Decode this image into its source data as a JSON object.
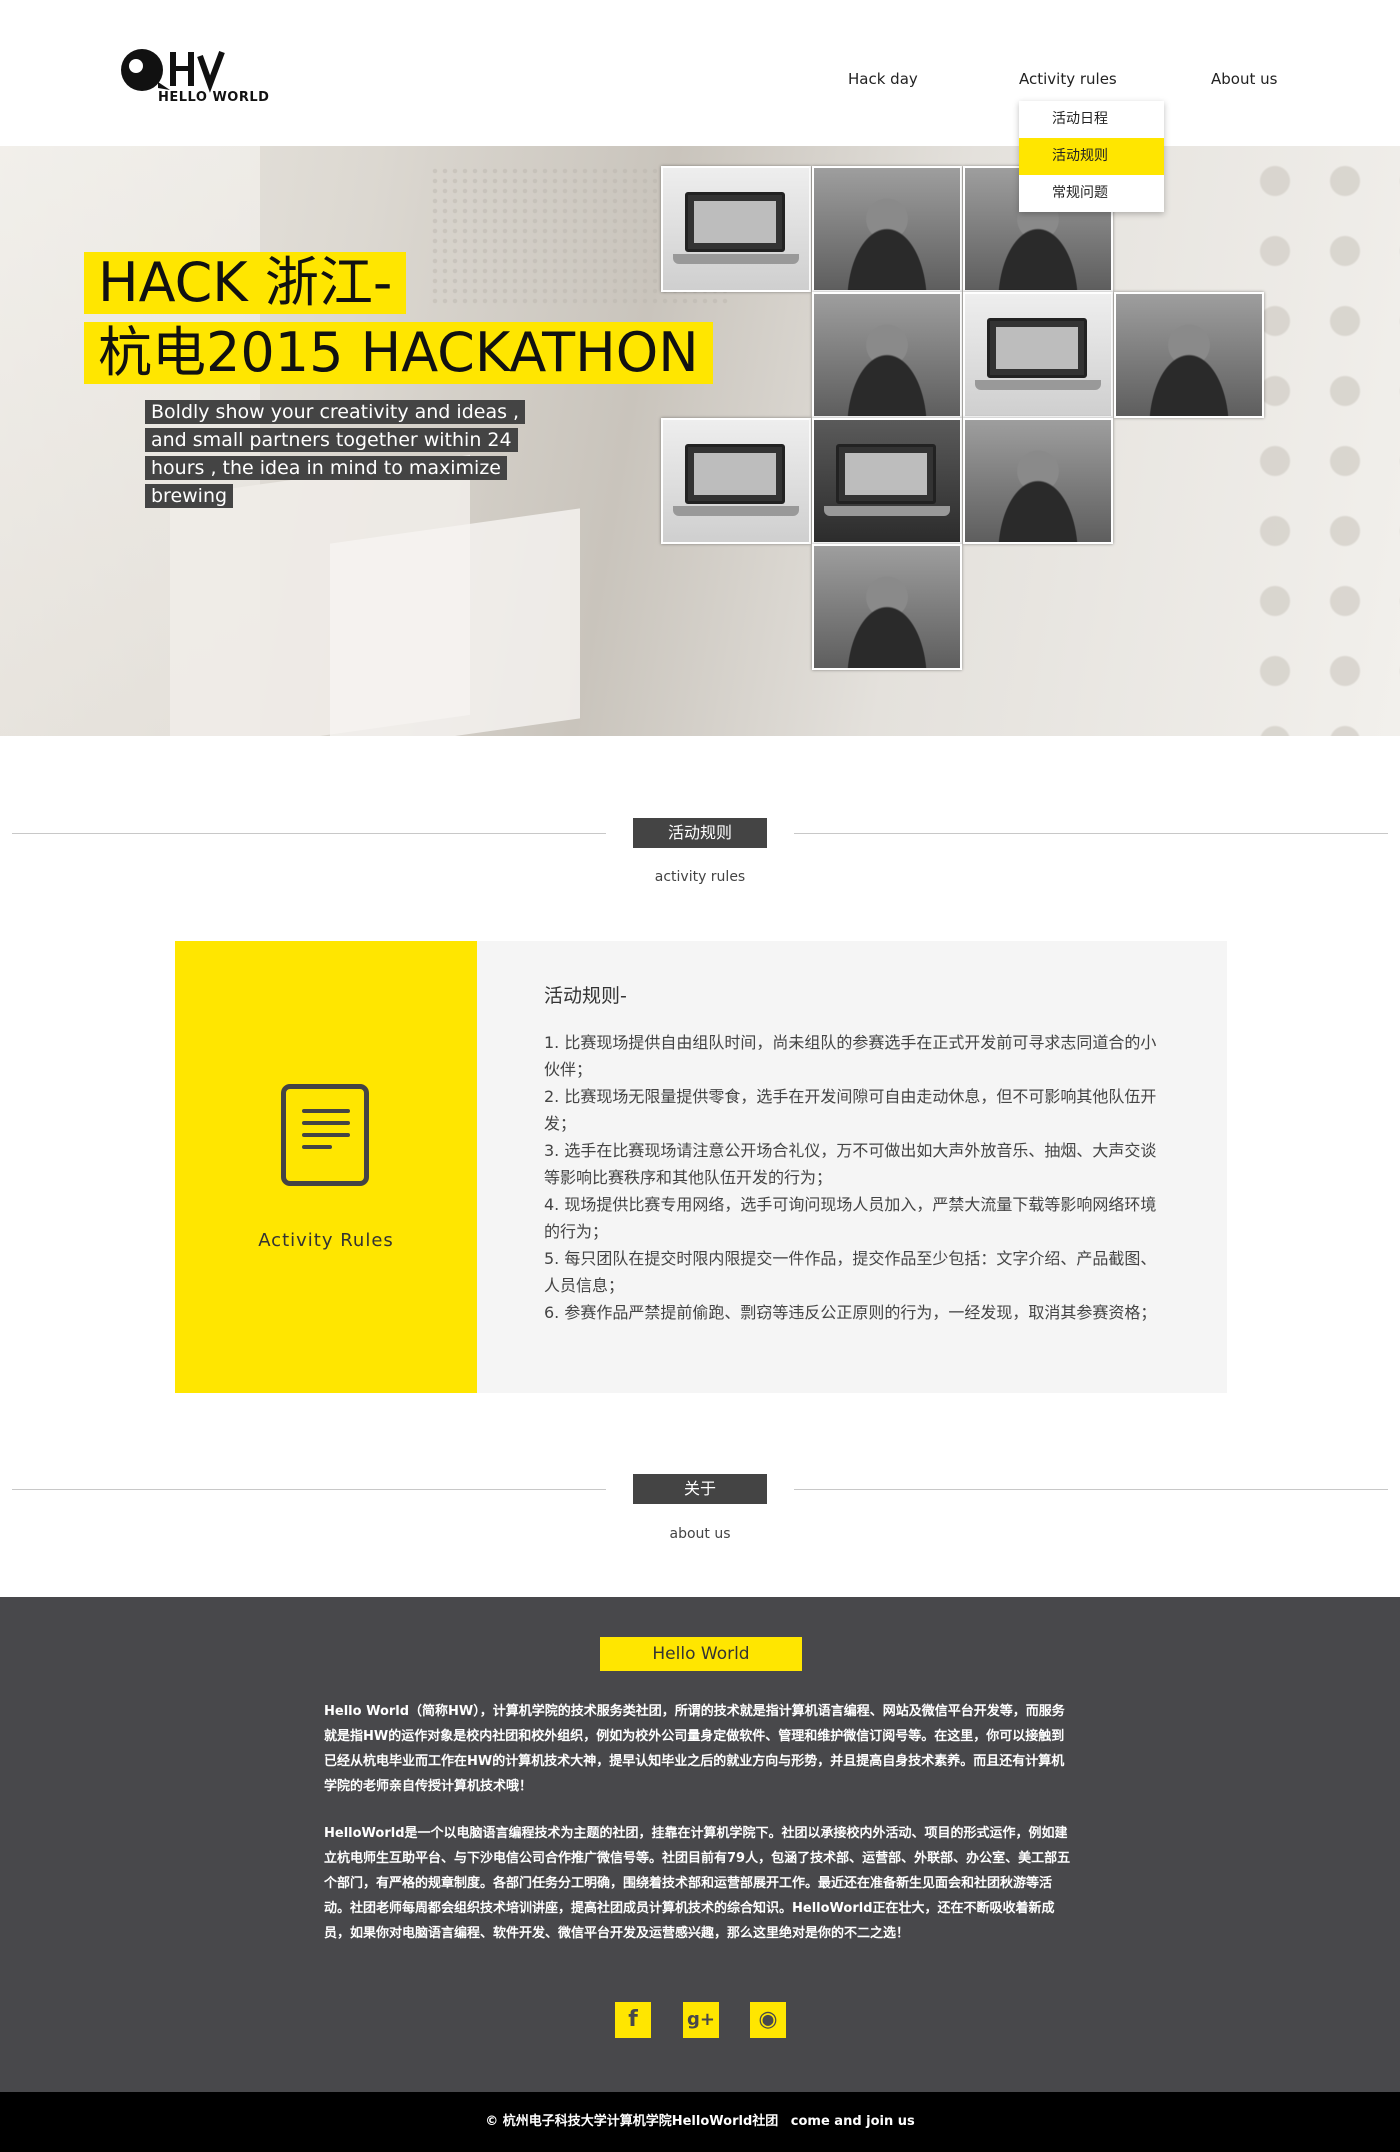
{
  "header": {
    "logo_text": "HELLO WORLD",
    "nav": {
      "hack_day": "Hack day",
      "activity_rules": "Activity rules",
      "about_us": "About us"
    },
    "dropdown": [
      "活动日程",
      "活动规则",
      "常规问题"
    ],
    "dropdown_active": "活动规则"
  },
  "hero": {
    "title_line1": "HACK 浙江-",
    "title_line2": "杭电2015 HACKATHON",
    "subtitle": "Boldly show your creativity and ideas , and small partners together within 24 hours , the idea in mind to maximize brewing"
  },
  "rules_section": {
    "label": "活动规则",
    "sub": "activity rules",
    "card_label": "Activity Rules",
    "heading": "活动规则-",
    "items": [
      "1. 比赛现场提供自由组队时间，尚未组队的参赛选手在正式开发前可寻求志同道合的小伙伴；",
      "2. 比赛现场无限量提供零食，选手在开发间隙可自由走动休息，但不可影响其他队伍开发；",
      "3. 选手在比赛现场请注意公开场合礼仪，万不可做出如大声外放音乐、抽烟、大声交谈等影响比赛秩序和其他队伍开发的行为；",
      "4. 现场提供比赛专用网络，选手可询问现场人员加入，严禁大流量下载等影响网络环境的行为；",
      "5. 每只团队在提交时限内限提交一件作品，提交作品至少包括：文字介绍、产品截图、人员信息；",
      "6. 参赛作品严禁提前偷跑、剽窃等违反公正原则的行为，一经发现，取消其参赛资格；"
    ]
  },
  "about_section": {
    "label": "关于",
    "sub": "about us"
  },
  "footer": {
    "badge": "Hello World",
    "paragraph1": "Hello World（简称HW），计算机学院的技术服务类社团，所谓的技术就是指计算机语言编程、网站及微信平台开发等，而服务就是指HW的运作对象是校内社团和校外组织，例如为校外公司量身定做软件、管理和维护微信订阅号等。在这里，你可以接触到已经从杭电毕业而工作在HW的计算机技术大神，提早认知毕业之后的就业方向与形势，并且提高自身技术素养。而且还有计算机学院的老师亲自传授计算机技术哦！",
    "paragraph2": "HelloWorld是一个以电脑语言编程技术为主题的社团，挂靠在计算机学院下。社团以承接校内外活动、项目的形式运作，例如建立杭电师生互助平台、与下沙电信公司合作推广微信号等。社团目前有79人，包涵了技术部、运营部、外联部、办公室、美工部五个部门，有严格的规章制度。各部门任务分工明确，围绕着技术部和运营部展开工作。最近还在准备新生见面会和社团秋游等活动。社团老师每周都会组织技术培训讲座，提高社团成员计算机技术的综合知识。HelloWorld正在壮大，还在不断吸收着新成员，如果你对电脑语言编程、软件开发、微信平台开发及运营感兴趣，那么这里绝对是你的不二之选！",
    "social": {
      "facebook": "f",
      "google_plus": "g+",
      "weibo": "◉"
    },
    "copyright": "© 杭州电子科技大学计算机学院HelloWorld社团",
    "join_link": "come and join us"
  },
  "colors": {
    "accent": "#ffe600",
    "dark": "#48484b",
    "label_bg": "#444444"
  }
}
